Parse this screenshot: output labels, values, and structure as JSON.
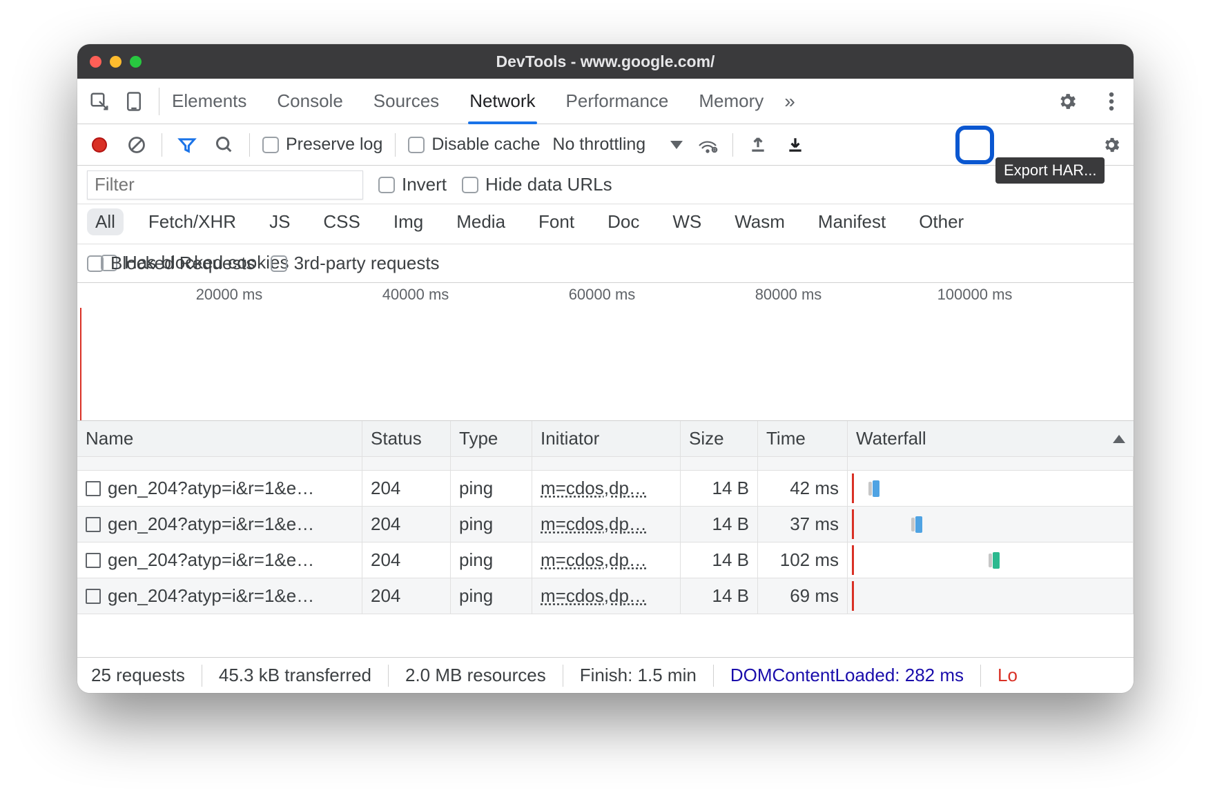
{
  "window": {
    "title": "DevTools - www.google.com/"
  },
  "tabs": [
    "Elements",
    "Console",
    "Sources",
    "Network",
    "Performance",
    "Memory"
  ],
  "toolbar": {
    "preserve_log": "Preserve log",
    "disable_cache": "Disable cache",
    "throttling": "No throttling",
    "export_tooltip": "Export HAR..."
  },
  "filter": {
    "placeholder": "Filter",
    "invert": "Invert",
    "hide_data_urls": "Hide data URLs",
    "has_blocked_cookies": "Has blocked cookies",
    "blocked_requests": "Blocked Requests",
    "third_party": "3rd-party requests"
  },
  "types": [
    "All",
    "Fetch/XHR",
    "JS",
    "CSS",
    "Img",
    "Media",
    "Font",
    "Doc",
    "WS",
    "Wasm",
    "Manifest",
    "Other"
  ],
  "timeline": {
    "ticks": [
      "20000 ms",
      "40000 ms",
      "60000 ms",
      "80000 ms",
      "100000 ms"
    ]
  },
  "columns": [
    "Name",
    "Status",
    "Type",
    "Initiator",
    "Size",
    "Time",
    "Waterfall"
  ],
  "rows": [
    {
      "name": "gen_204?atyp=i&r=1&e…",
      "status": "204",
      "type": "ping",
      "initiator": "m=cdos,dp…",
      "size": "14 B",
      "time": "42 ms"
    },
    {
      "name": "gen_204?atyp=i&r=1&e…",
      "status": "204",
      "type": "ping",
      "initiator": "m=cdos,dp…",
      "size": "14 B",
      "time": "37 ms"
    },
    {
      "name": "gen_204?atyp=i&r=1&e…",
      "status": "204",
      "type": "ping",
      "initiator": "m=cdos,dp…",
      "size": "14 B",
      "time": "102 ms"
    },
    {
      "name": "gen_204?atyp=i&r=1&e…",
      "status": "204",
      "type": "ping",
      "initiator": "m=cdos,dp…",
      "size": "14 B",
      "time": "69 ms"
    }
  ],
  "status": {
    "requests": "25 requests",
    "transferred": "45.3 kB transferred",
    "resources": "2.0 MB resources",
    "finish": "Finish: 1.5 min",
    "dcl": "DOMContentLoaded: 282 ms",
    "load": "Lo"
  }
}
